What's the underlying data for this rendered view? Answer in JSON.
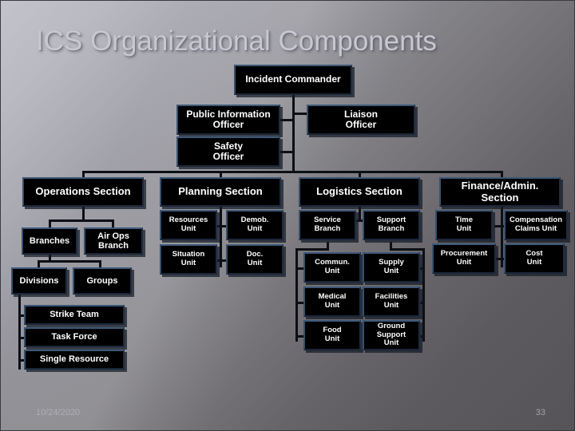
{
  "slide": {
    "title": "ICS Organizational Components",
    "footer_date": "10/24/2020",
    "page_number": "33",
    "accent_color": "#2b3f5c",
    "box_fill": "#000000",
    "title_color": "#c8c8d2"
  },
  "chart_data": {
    "type": "diagram",
    "title": "ICS Organizational Components",
    "orientation": "top-down organizational chart",
    "nodes": [
      {
        "id": "ic",
        "label": "Incident Commander",
        "level": 0
      },
      {
        "id": "pio",
        "label": "Public Information Officer",
        "level": 1,
        "parent": "ic"
      },
      {
        "id": "liaison",
        "label": "Liaison Officer",
        "level": 1,
        "parent": "ic"
      },
      {
        "id": "safety",
        "label": "Safety Officer",
        "level": 1,
        "parent": "ic"
      },
      {
        "id": "operations",
        "label": "Operations Section",
        "level": 2,
        "parent": "ic"
      },
      {
        "id": "planning",
        "label": "Planning Section",
        "level": 2,
        "parent": "ic"
      },
      {
        "id": "logistics",
        "label": "Logistics Section",
        "level": 2,
        "parent": "ic"
      },
      {
        "id": "finance",
        "label": "Finance/Admin. Section",
        "level": 2,
        "parent": "ic"
      },
      {
        "id": "branches",
        "label": "Branches",
        "level": 3,
        "parent": "operations"
      },
      {
        "id": "airops",
        "label": "Air Ops Branch",
        "level": 3,
        "parent": "operations"
      },
      {
        "id": "divisions",
        "label": "Divisions",
        "level": 4,
        "parent": "branches"
      },
      {
        "id": "groups",
        "label": "Groups",
        "level": 4,
        "parent": "branches"
      },
      {
        "id": "striketeam",
        "label": "Strike Team",
        "level": 5,
        "parent": "divisions"
      },
      {
        "id": "taskforce",
        "label": "Task Force",
        "level": 5,
        "parent": "divisions"
      },
      {
        "id": "singleresource",
        "label": "Single Resource",
        "level": 5,
        "parent": "divisions"
      },
      {
        "id": "resources",
        "label": "Resources Unit",
        "level": 3,
        "parent": "planning"
      },
      {
        "id": "demob",
        "label": "Demob. Unit",
        "level": 3,
        "parent": "planning"
      },
      {
        "id": "situation",
        "label": "Situation Unit",
        "level": 3,
        "parent": "planning"
      },
      {
        "id": "doc",
        "label": "Doc. Unit",
        "level": 3,
        "parent": "planning"
      },
      {
        "id": "service",
        "label": "Service Branch",
        "level": 3,
        "parent": "logistics"
      },
      {
        "id": "support",
        "label": "Support Branch",
        "level": 3,
        "parent": "logistics"
      },
      {
        "id": "commun",
        "label": "Commun. Unit",
        "level": 4,
        "parent": "service"
      },
      {
        "id": "medical",
        "label": "Medical Unit",
        "level": 4,
        "parent": "service"
      },
      {
        "id": "food",
        "label": "Food Unit",
        "level": 4,
        "parent": "service"
      },
      {
        "id": "supply",
        "label": "Supply Unit",
        "level": 4,
        "parent": "support"
      },
      {
        "id": "facilities",
        "label": "Facilities Unit",
        "level": 4,
        "parent": "support"
      },
      {
        "id": "groundsupport",
        "label": "Ground Support Unit",
        "level": 4,
        "parent": "support"
      },
      {
        "id": "time",
        "label": "Time Unit",
        "level": 3,
        "parent": "finance"
      },
      {
        "id": "compensation",
        "label": "Compensation Claims Unit",
        "level": 3,
        "parent": "finance"
      },
      {
        "id": "procurement",
        "label": "Procurement Unit",
        "level": 3,
        "parent": "finance"
      },
      {
        "id": "cost",
        "label": "Cost Unit",
        "level": 3,
        "parent": "finance"
      }
    ]
  },
  "chart": {
    "incident_commander": "Incident Commander",
    "public_information_officer_l1": "Public Information",
    "public_information_officer_l2": "Officer",
    "liaison_officer_l1": "Liaison",
    "liaison_officer_l2": "Officer",
    "safety_officer_l1": "Safety",
    "safety_officer_l2": "Officer",
    "operations_section": "Operations Section",
    "planning_section": "Planning Section",
    "logistics_section": "Logistics Section",
    "finance_section_l1": "Finance/Admin.",
    "finance_section_l2": "Section",
    "branches": "Branches",
    "air_ops_branch_l1": "Air Ops",
    "air_ops_branch_l2": "Branch",
    "divisions": "Divisions",
    "groups": "Groups",
    "strike_team": "Strike Team",
    "task_force": "Task Force",
    "single_resource": "Single Resource",
    "resources_unit_l1": "Resources",
    "resources_unit_l2": "Unit",
    "demob_unit_l1": "Demob.",
    "demob_unit_l2": "Unit",
    "situation_unit_l1": "Situation",
    "situation_unit_l2": "Unit",
    "doc_unit_l1": "Doc.",
    "doc_unit_l2": "Unit",
    "service_branch_l1": "Service",
    "service_branch_l2": "Branch",
    "support_branch_l1": "Support",
    "support_branch_l2": "Branch",
    "commun_unit_l1": "Commun.",
    "commun_unit_l2": "Unit",
    "supply_unit_l1": "Supply",
    "supply_unit_l2": "Unit",
    "medical_unit_l1": "Medical",
    "medical_unit_l2": "Unit",
    "facilities_unit_l1": "Facilities",
    "facilities_unit_l2": "Unit",
    "food_unit_l1": "Food",
    "food_unit_l2": "Unit",
    "ground_support_unit_l1": "Ground",
    "ground_support_unit_l2": "Support Unit",
    "time_unit_l1": "Time",
    "time_unit_l2": "Unit",
    "compensation_unit_l1": "Compensation",
    "compensation_unit_l2": "Claims Unit",
    "procurement_unit_l1": "Procurement",
    "procurement_unit_l2": "Unit",
    "cost_unit_l1": "Cost",
    "cost_unit_l2": "Unit"
  }
}
